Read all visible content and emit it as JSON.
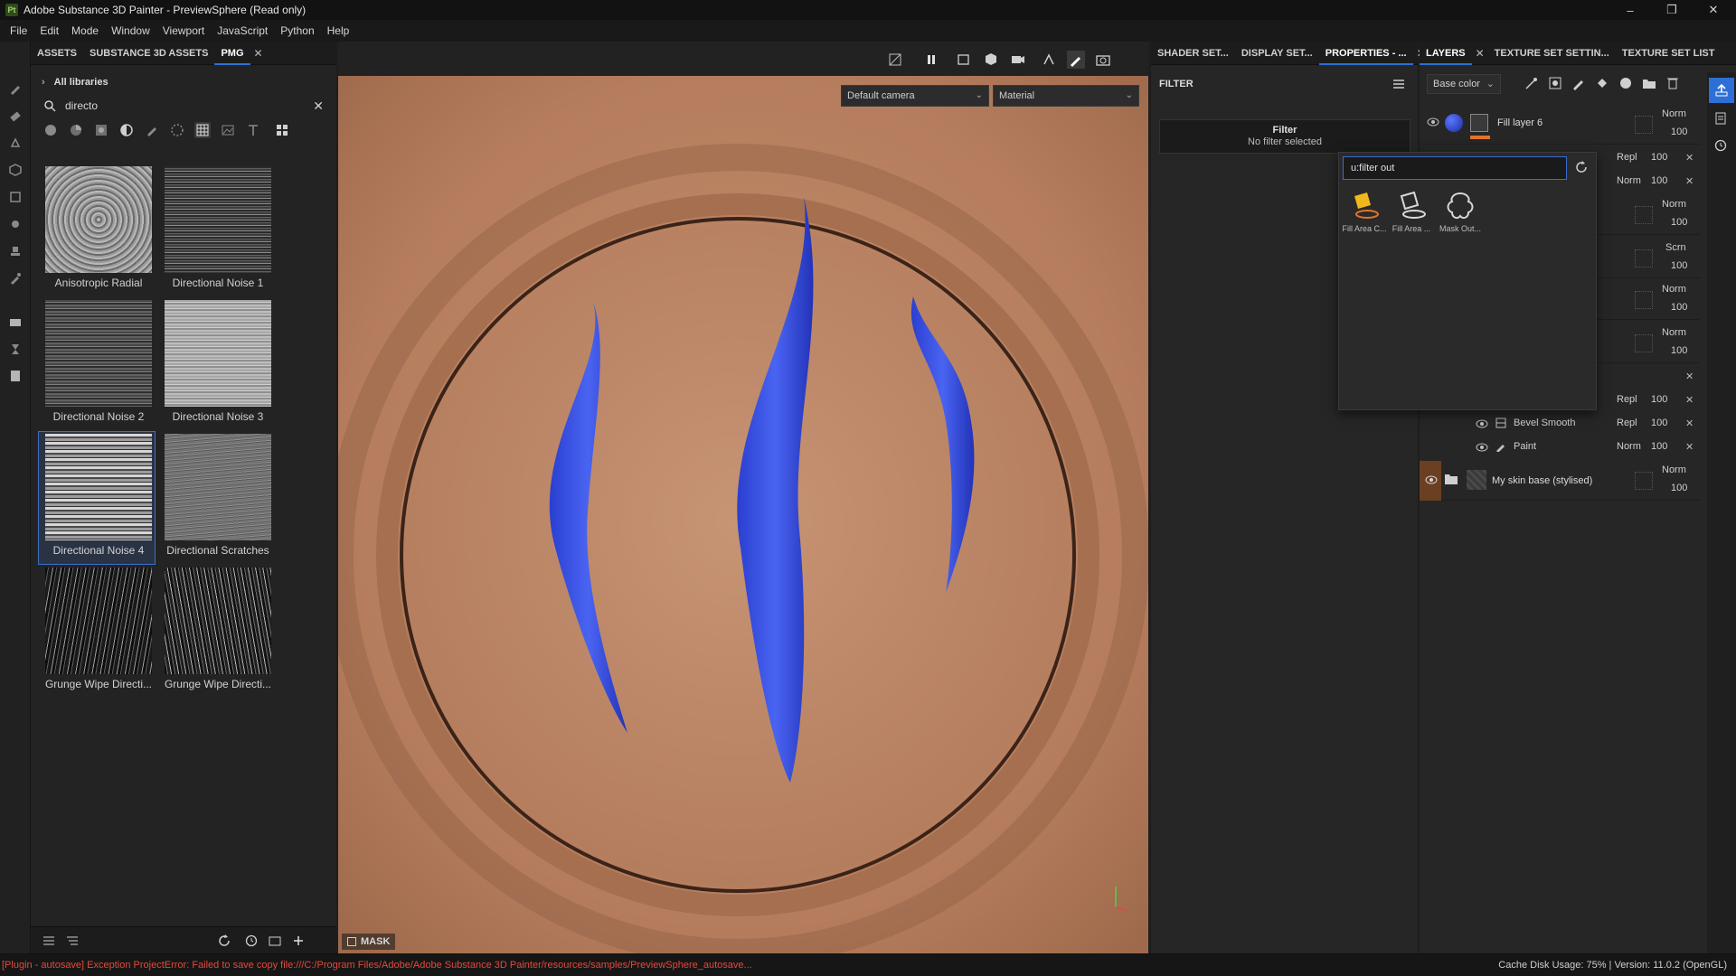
{
  "window": {
    "app_badge": "Pt",
    "title": "Adobe Substance 3D Painter - PreviewSphere (Read only)",
    "controls": {
      "minimize": "–",
      "maximize": "❐",
      "close": "✕"
    }
  },
  "menubar": {
    "items": [
      "File",
      "Edit",
      "Mode",
      "Window",
      "Viewport",
      "JavaScript",
      "Python",
      "Help"
    ]
  },
  "assets_panel": {
    "tabs": [
      {
        "label": "ASSETS",
        "active": false
      },
      {
        "label": "SUBSTANCE 3D ASSETS",
        "active": false
      },
      {
        "label": "PMG",
        "active": true
      }
    ],
    "library_label": "All libraries",
    "search_value": "directo",
    "assets": [
      {
        "name": "Anisotropic Radial",
        "selected": false
      },
      {
        "name": "Directional Noise 1",
        "selected": false
      },
      {
        "name": "Directional Noise 2",
        "selected": false
      },
      {
        "name": "Directional Noise 3",
        "selected": false
      },
      {
        "name": "Directional Noise 4",
        "selected": true
      },
      {
        "name": "Directional Scratches",
        "selected": false
      },
      {
        "name": "Grunge Wipe Directi...",
        "selected": false
      },
      {
        "name": "Grunge Wipe Directi...",
        "selected": false
      }
    ]
  },
  "viewport": {
    "camera_select": "Default camera",
    "channel_select": "Material",
    "mask_label": "MASK",
    "accent_color": "#3a55e8"
  },
  "properties_panel": {
    "tabs": [
      {
        "label": "SHADER SET...",
        "active": false
      },
      {
        "label": "DISPLAY SET...",
        "active": false
      },
      {
        "label": "PROPERTIES - ...",
        "active": true
      }
    ],
    "section_title": "FILTER",
    "filter_title": "Filter",
    "filter_status": "No filter selected"
  },
  "layers_panel": {
    "tabs": [
      {
        "label": "LAYERS",
        "active": true
      },
      {
        "label": "TEXTURE SET SETTIN...",
        "active": false
      },
      {
        "label": "TEXTURE SET LIST",
        "active": false
      }
    ],
    "channel_select": "Base color",
    "layers": [
      {
        "name": "Fill layer 6",
        "blend": "Norm",
        "opacity": "100"
      },
      {
        "name": "",
        "blend": "Repl",
        "opacity": "100"
      },
      {
        "name": "",
        "blend": "Norm",
        "opacity": "100"
      },
      {
        "name": "",
        "blend": "Norm",
        "opacity": "100"
      },
      {
        "name": "",
        "blend": "Scrn",
        "opacity": "100"
      },
      {
        "name": "",
        "blend": "Norm",
        "opacity": "100"
      },
      {
        "name": "",
        "blend": "Norm",
        "opacity": "100"
      },
      {
        "name": "",
        "blend": "Repl",
        "opacity": "100"
      },
      {
        "name": "Bevel Smooth",
        "blend": "Repl",
        "opacity": "100"
      },
      {
        "name": "Paint",
        "blend": "Norm",
        "opacity": "100"
      },
      {
        "name": "My skin base (stylised)",
        "blend": "Norm",
        "opacity": "100"
      }
    ]
  },
  "popup": {
    "search_value": "u:filter out",
    "items": [
      {
        "name": "Fill Area C..."
      },
      {
        "name": "Fill Area ..."
      },
      {
        "name": "Mask Out..."
      }
    ]
  },
  "statusbar": {
    "error": "[Plugin - autosave] Exception ProjectError: Failed to save copy file:///C:/Program Files/Adobe/Adobe Substance 3D Painter/resources/samples/PreviewSphere_autosave...",
    "info": "Cache Disk Usage:    75% | Version: 11.0.2 (OpenGL)"
  }
}
